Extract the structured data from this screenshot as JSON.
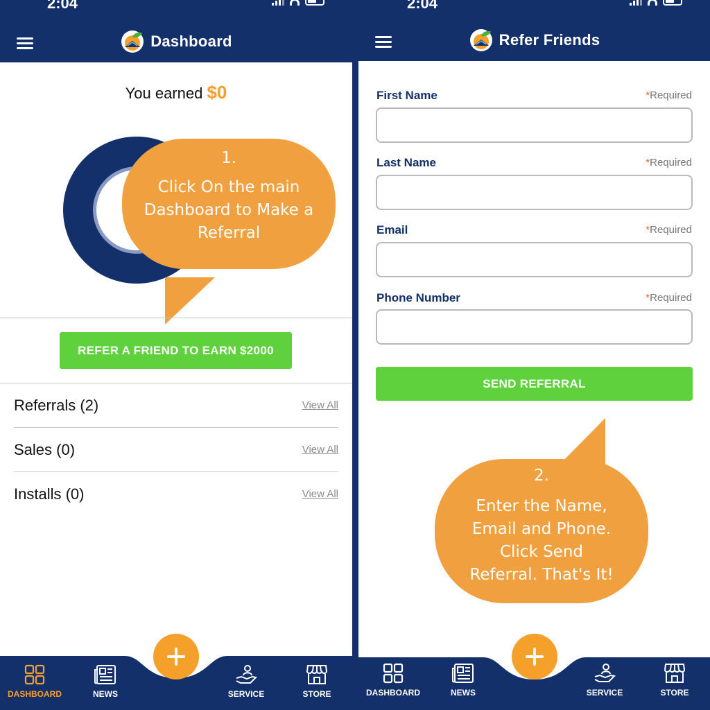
{
  "status": {
    "time": "2:04"
  },
  "dashboard": {
    "title": "Dashboard",
    "earned_label": "You earned",
    "earned_amount": "$0",
    "callout": {
      "number": "1.",
      "lines": [
        "Click On the main",
        "Dashboard to Make a",
        "Referral"
      ]
    },
    "refer_button": "REFER A FRIEND TO EARN $2000",
    "rows": [
      {
        "label": "Referrals (2)",
        "link": "View All"
      },
      {
        "label": "Sales (0)",
        "link": "View All"
      },
      {
        "label": "Installs (0)",
        "link": "View All"
      }
    ]
  },
  "refer": {
    "title": "Refer Friends",
    "fields": [
      {
        "label": "First Name",
        "required": "Required",
        "value": ""
      },
      {
        "label": "Last Name",
        "required": "Required",
        "value": ""
      },
      {
        "label": "Email",
        "required": "Required",
        "value": ""
      },
      {
        "label": "Phone Number",
        "required": "Required",
        "value": ""
      }
    ],
    "send_button": "SEND REFERRAL",
    "callout": {
      "number": "2.",
      "lines": [
        "Enter the Name,",
        "Email and Phone.",
        "Click Send",
        "Referral. That's It!"
      ]
    }
  },
  "tabs": [
    {
      "label": "DASHBOARD",
      "icon": "grid-icon"
    },
    {
      "label": "NEWS",
      "icon": "newspaper-icon"
    },
    {
      "label": "SERVICE",
      "icon": "hand-service-icon"
    },
    {
      "label": "STORE",
      "icon": "storefront-icon"
    }
  ],
  "colors": {
    "navy": "#13306b",
    "orange": "#f5a02a",
    "green": "#5ed13c"
  }
}
